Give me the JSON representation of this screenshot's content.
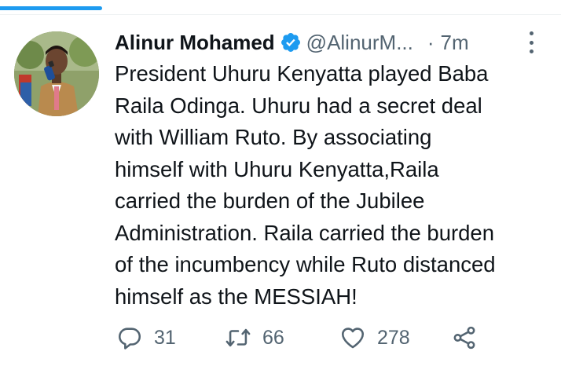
{
  "tweet": {
    "author_name": "Alinur Mohamed",
    "handle": "@AlinurM...",
    "separator": "·",
    "time": "7m",
    "text": "President Uhuru Kenyatta played Baba\nRaila Odinga. Uhuru had a secret deal\nwith William Ruto. By associating\nhimself with Uhuru Kenyatta,Raila\ncarried the burden of the Jubilee\nAdministration. Raila carried the burden\nof the incumbency while Ruto distanced\nhimself as the MESSIAH!",
    "verified": true
  },
  "actions": {
    "reply": {
      "icon": "reply-icon",
      "count": "31"
    },
    "retweet": {
      "icon": "retweet-icon",
      "count": "66"
    },
    "like": {
      "icon": "heart-icon",
      "count": "278"
    },
    "share": {
      "icon": "share-icon"
    }
  },
  "colors": {
    "accent": "#1d9bf0",
    "text": "#0f1419",
    "secondary": "#536471"
  }
}
